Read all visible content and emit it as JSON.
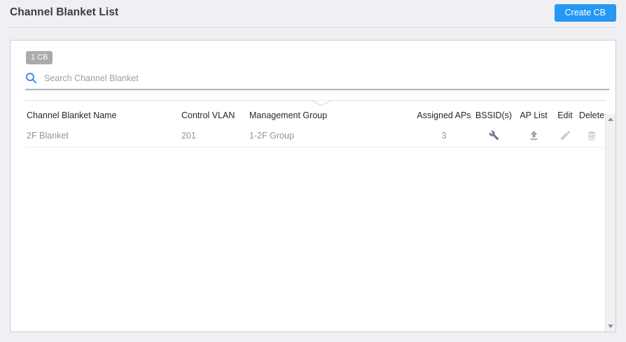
{
  "page": {
    "title": "Channel Blanket List",
    "create_button_label": "Create CB"
  },
  "panel": {
    "count_badge": "1 CB",
    "search_placeholder": "Search Channel Blanket"
  },
  "table": {
    "columns": [
      "Channel Blanket Name",
      "Control VLAN",
      "Management Group",
      "Assigned APs",
      "BSSID(s)",
      "AP List",
      "Edit",
      "Delete"
    ],
    "rows": [
      {
        "name": "2F Blanket",
        "control_vlan": "201",
        "management_group": "1-2F Group",
        "assigned_aps": "3",
        "bssid_icon": "wrench-icon",
        "ap_list_icon": "upload-icon",
        "edit_icon": "pencil-icon",
        "delete_icon": "trash-icon"
      }
    ]
  },
  "colors": {
    "accent": "#2697f2",
    "badge-bg": "#ababab",
    "underline": "#a9b5c2",
    "icon-blue": "#3c8ee9",
    "icon-wrench": "#72809e",
    "icon-upload": "#9aa3ad",
    "icon-light": "#c6cbd2",
    "page-bg": "#eef0f4"
  }
}
